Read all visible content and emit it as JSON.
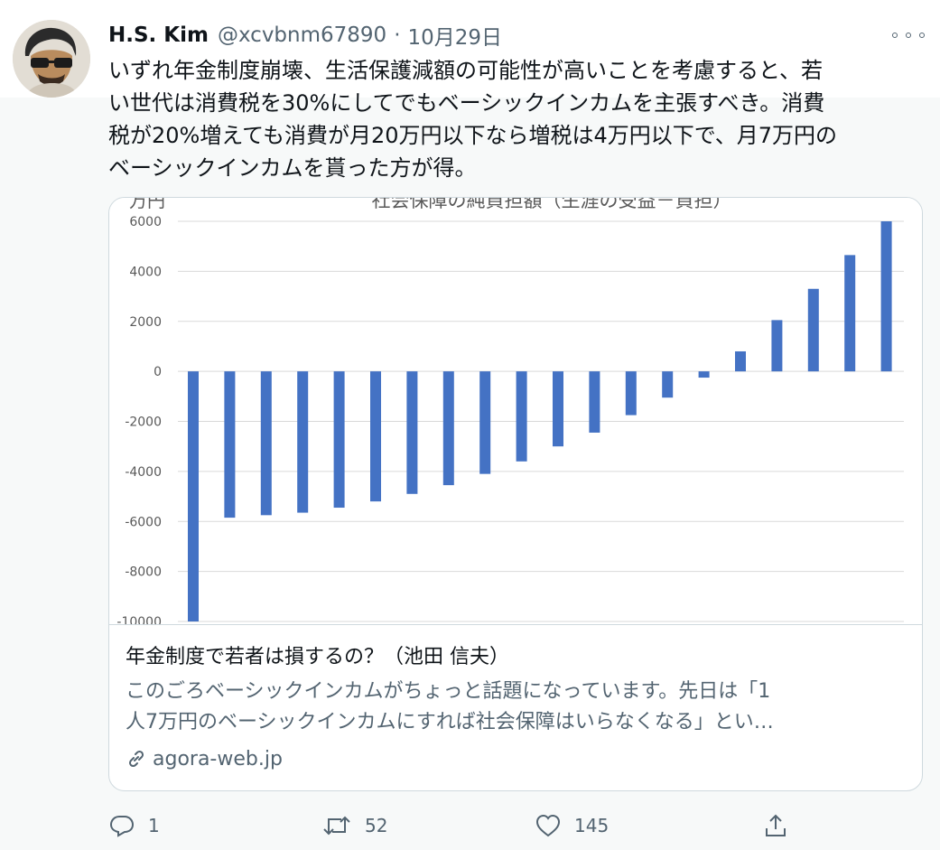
{
  "tweet": {
    "author_name": "H.S. Kim",
    "author_handle": "@xcvbnm67890",
    "separator": "·",
    "date": "10月29日",
    "text_lines": [
      "いずれ年金制度崩壊、生活保護減額の可能性が高いことを考慮すると、若",
      "い世代は消費税を30%にしてでもベーシックインカムを主張すべき。消費",
      "税が20%増えても消費が月20万円以下なら増税は4万円以下で、月7万円の",
      "ベーシックインカムを貰った方が得。"
    ]
  },
  "card": {
    "title": "年金制度で若者は損するの？（池田 信夫）",
    "description_lines": [
      "このごろベーシックインカムがちょっと話題になっています。先日は「1",
      "人7万円のベーシックインカムにすれば社会保障はいらなくなる」とい…"
    ],
    "domain": "agora-web.jp"
  },
  "actions": {
    "reply": {
      "icon": "reply-icon",
      "count": "1"
    },
    "retweet": {
      "icon": "retweet-icon",
      "count": "52"
    },
    "like": {
      "icon": "heart-icon",
      "count": "145"
    },
    "share": {
      "icon": "share-icon"
    }
  },
  "colors": {
    "bar": "#4472c4",
    "muted_text": "#536471",
    "border": "#cfd9de"
  },
  "chart_data": {
    "type": "bar",
    "title": "社会保障の純負担額（生涯の受益－負担）",
    "ylabel": "万円",
    "ylim": [
      -10000,
      6000
    ],
    "y_ticks": [
      6000,
      4000,
      2000,
      0,
      -2000,
      -4000,
      -6000,
      -8000,
      -10000
    ],
    "y_tick_labels": [
      "6000",
      "4000",
      "2000",
      "0",
      "-2000",
      "-4000",
      "-6000",
      "-8000",
      "-10000"
    ],
    "grid": true,
    "values": [
      -10000,
      -5850,
      -5750,
      -5650,
      -5450,
      -5200,
      -4900,
      -4550,
      -4100,
      -3600,
      -3000,
      -2450,
      -1750,
      -1050,
      -250,
      800,
      2050,
      3300,
      4650,
      6000
    ]
  }
}
